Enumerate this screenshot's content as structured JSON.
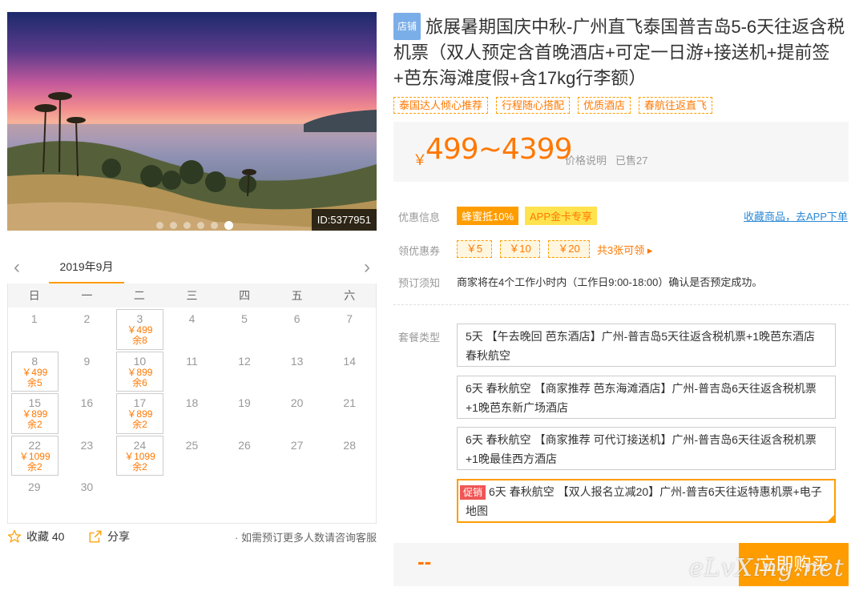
{
  "hero": {
    "id_label": "ID:5377951",
    "dots": 6,
    "active_dot": 5
  },
  "calendar": {
    "month": "2019年9月",
    "weekdays": [
      "日",
      "一",
      "二",
      "三",
      "四",
      "五",
      "六"
    ],
    "first_weekday": 0,
    "days_in_month": 30,
    "available": {
      "3": {
        "price": "￥499",
        "stock": "余8"
      },
      "8": {
        "price": "￥499",
        "stock": "余5"
      },
      "10": {
        "price": "￥899",
        "stock": "余6"
      },
      "15": {
        "price": "￥899",
        "stock": "余2"
      },
      "17": {
        "price": "￥899",
        "stock": "余2"
      },
      "22": {
        "price": "￥1099",
        "stock": "余2"
      },
      "24": {
        "price": "￥1099",
        "stock": "余2"
      }
    }
  },
  "actions": {
    "favorite_label": "收藏 40",
    "share_label": "分享",
    "note": "· 如需预订更多人数请咨询客服"
  },
  "product": {
    "shop_tag": "店铺",
    "title": "旅展暑期国庆中秋-广州直飞泰国普吉岛5-6天往返含税机票（双人预定含首晚酒店+可定一日游+接送机+提前签+芭东海滩度假+含17kg行李额）",
    "tags": [
      "泰国达人倾心推荐",
      "行程随心搭配",
      "优质酒店",
      "春航往返直飞"
    ]
  },
  "price": {
    "currency": "￥",
    "range": "499~4399",
    "explain": "价格说明",
    "sold": "已售27"
  },
  "promo": {
    "label": "优惠信息",
    "badge_honey": "蜂蜜抵10%",
    "badge_app": "APP金卡专享",
    "fav_link": "收藏商品，去APP下单"
  },
  "coupons": {
    "label": "领优惠券",
    "items": [
      "￥5",
      "￥10",
      "￥20"
    ],
    "more": "共3张可领 ▸"
  },
  "booking": {
    "label": "预订须知",
    "notice": "商家将在4个工作小时内（工作日9:00-18:00）确认是否预定成功。"
  },
  "packages": {
    "label": "套餐类型",
    "items": [
      {
        "text": "5天 【午去晚回 芭东酒店】广州-普吉岛5天往返含税机票+1晚芭东酒店 春秋航空",
        "promo": ""
      },
      {
        "text": "6天 春秋航空 【商家推荐 芭东海滩酒店】广州-普吉岛6天往返含税机票+1晚芭东新广场酒店",
        "promo": ""
      },
      {
        "text": "6天 春秋航空 【商家推荐 可代订接送机】广州-普吉岛6天往返含税机票+1晚最佳西方酒店",
        "promo": ""
      },
      {
        "text": "6天 春秋航空 【双人报名立减20】广州-普吉6天往返特惠机票+电子地图",
        "promo": "促销"
      }
    ]
  },
  "buy": {
    "price": "--",
    "button": "立即购买"
  },
  "watermark": "eLvXing.net",
  "colors": {
    "accent": "#ff9d00",
    "price": "#ff7800",
    "link": "#2c89d6",
    "promo": "#f05656"
  }
}
